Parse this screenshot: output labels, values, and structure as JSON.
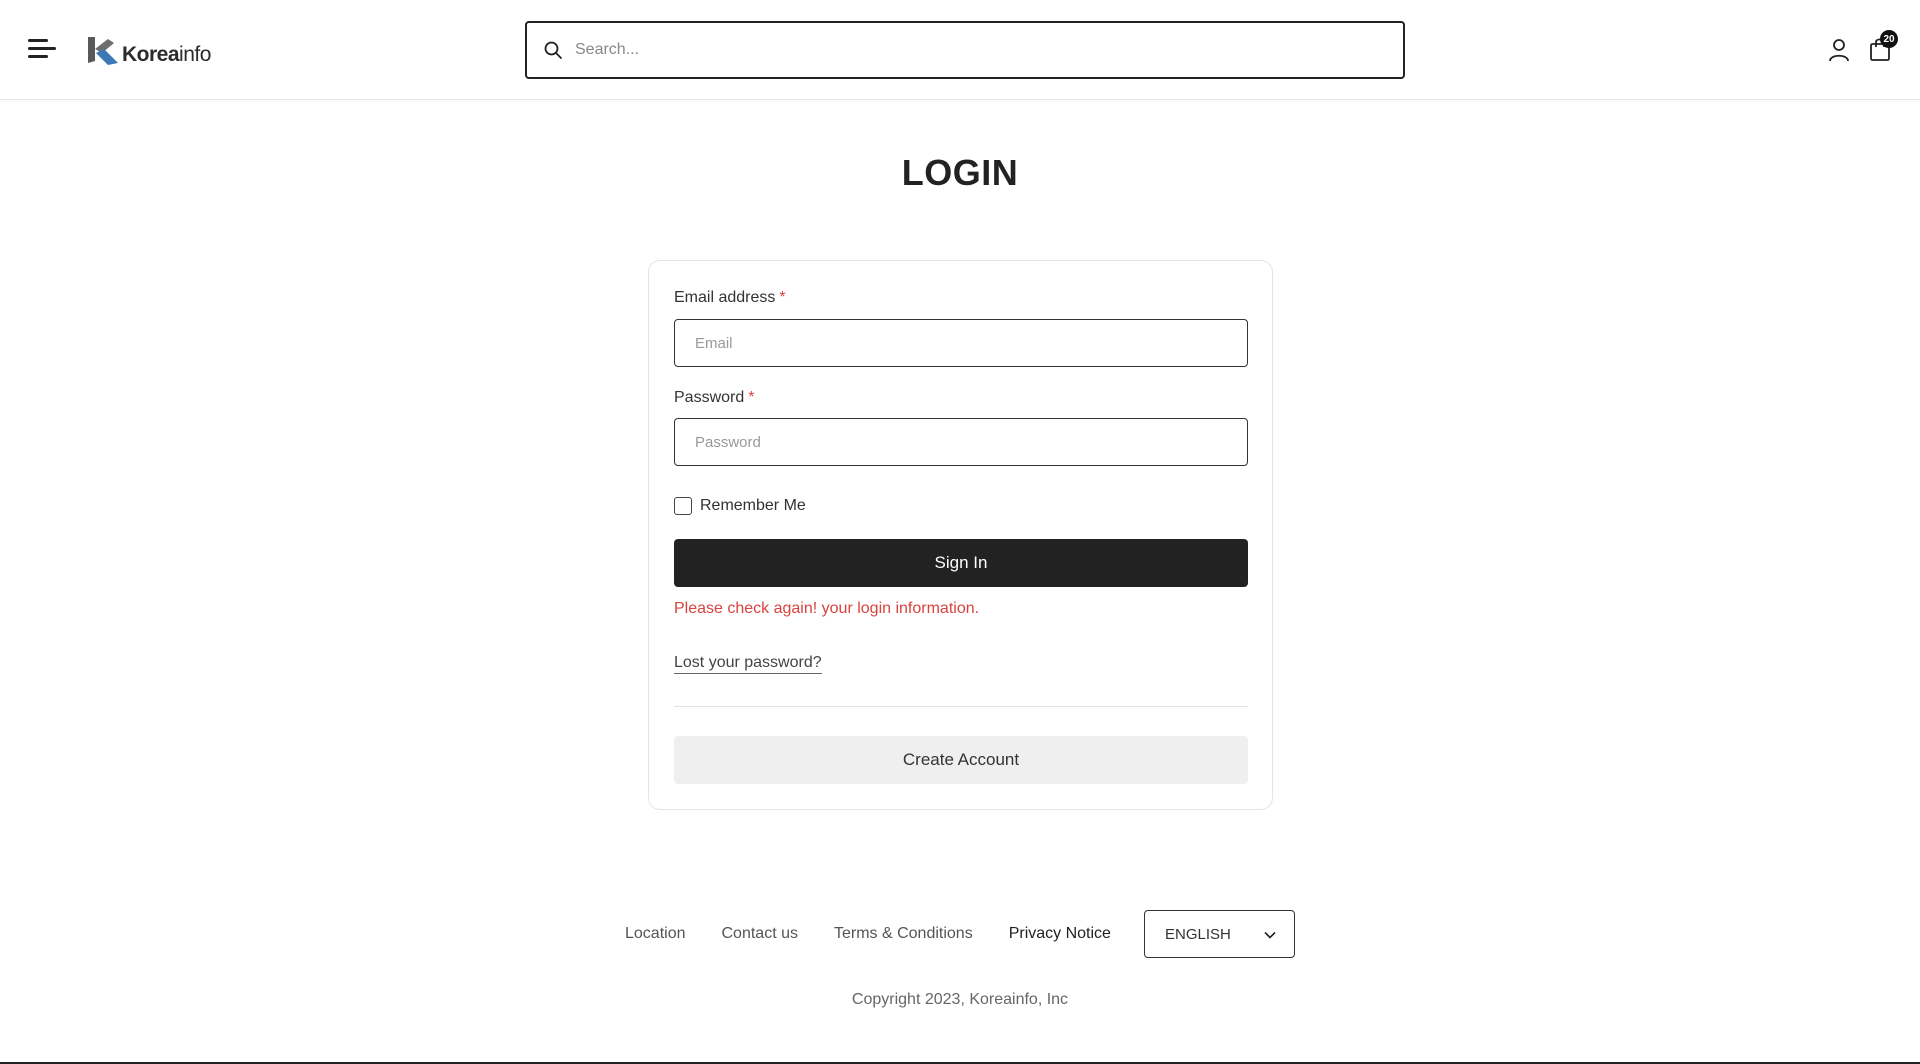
{
  "header": {
    "logo_text_bold": "Korea",
    "logo_text_light": "info",
    "search_placeholder": "Search...",
    "cart_count": "20"
  },
  "page": {
    "title": "LOGIN"
  },
  "form": {
    "email_label": "Email address",
    "email_placeholder": "Email",
    "password_label": "Password",
    "password_placeholder": "Password",
    "required_mark": "*",
    "remember_label": "Remember Me",
    "signin_label": "Sign In",
    "error_message": "Please check again! your login information.",
    "lost_password": "Lost your password?",
    "create_account": "Create Account"
  },
  "footer": {
    "links": [
      "Location",
      "Contact us",
      "Terms & Conditions",
      "Privacy Notice"
    ],
    "language": "ENGLISH",
    "copyright": "Copyright 2023, Koreainfo, Inc"
  },
  "colors": {
    "primary": "#222222",
    "error": "#d9433f",
    "logo_dark": "#555555",
    "logo_blue": "#3b78b4"
  },
  "icons": {
    "menu": "hamburger-menu-icon",
    "search": "search-icon",
    "user": "user-icon",
    "cart": "shopping-bag-icon",
    "dropdown": "chevron-down-icon"
  }
}
